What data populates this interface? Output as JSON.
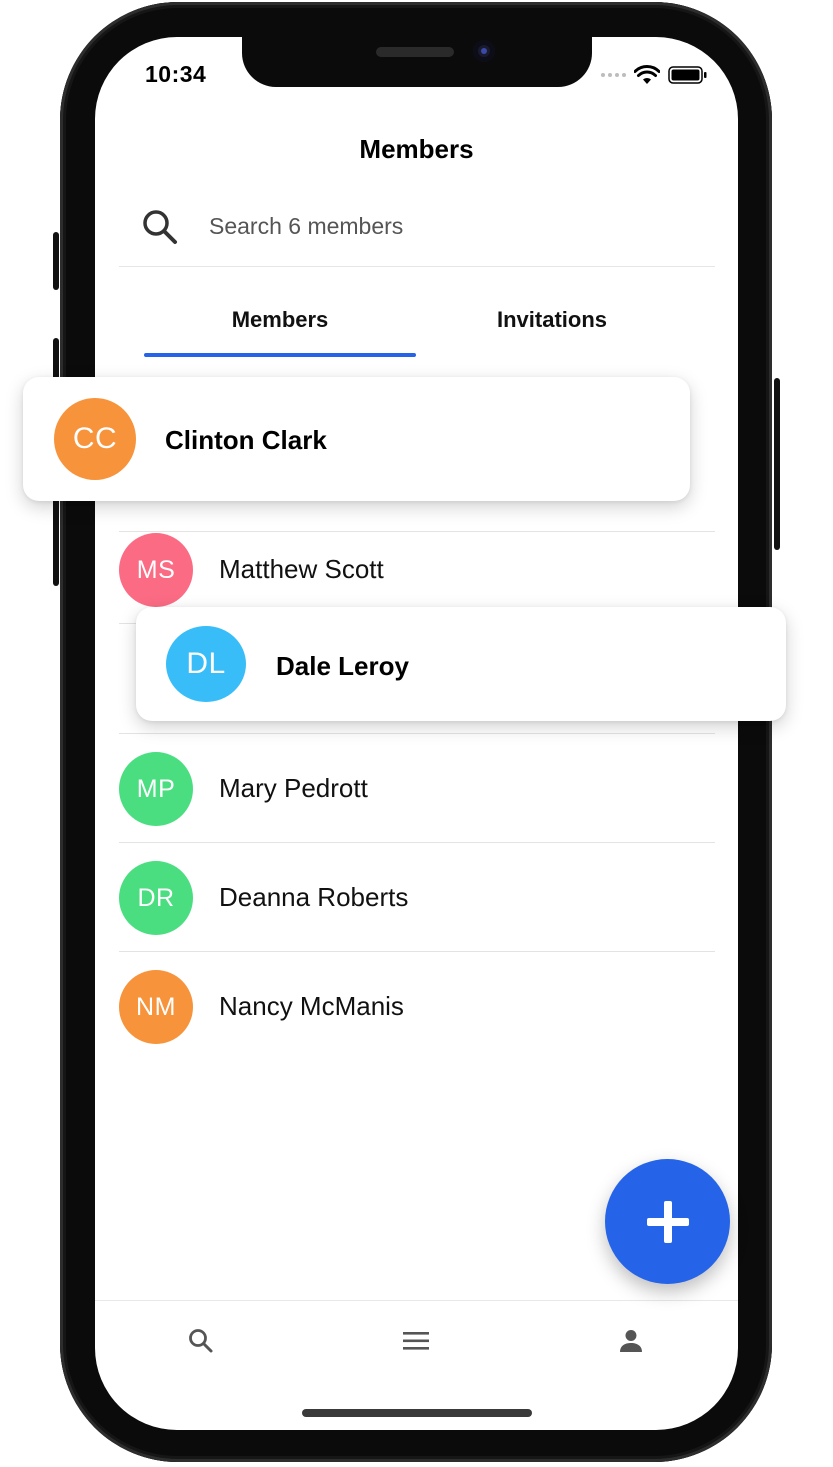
{
  "status_bar": {
    "time": "10:34"
  },
  "header": {
    "title": "Members"
  },
  "search": {
    "placeholder": "Search 6 members"
  },
  "tabs": [
    {
      "label": "Members",
      "active": true
    },
    {
      "label": "Invitations",
      "active": false
    }
  ],
  "members": [
    {
      "initials": "CC",
      "name": "Clinton Clark",
      "color": "#f7933b",
      "dragging": true
    },
    {
      "initials": "MS",
      "name": "Matthew Scott",
      "color": "#fb6b84"
    },
    {
      "initials": "DL",
      "name": "Dale Leroy",
      "color": "#38bdf8",
      "dragging": true
    },
    {
      "initials": "MP",
      "name": "Mary Pedrott",
      "color": "#4ade80"
    },
    {
      "initials": "DR",
      "name": "Deanna Roberts",
      "color": "#4ade80"
    },
    {
      "initials": "NM",
      "name": "Nancy McManis",
      "color": "#f7933b"
    }
  ],
  "fab": {
    "icon": "plus-icon",
    "color": "#2563e8"
  },
  "bottom_nav": [
    {
      "icon": "search-icon"
    },
    {
      "icon": "menu-icon"
    },
    {
      "icon": "person-icon"
    }
  ],
  "colors": {
    "accent": "#2563e8"
  }
}
